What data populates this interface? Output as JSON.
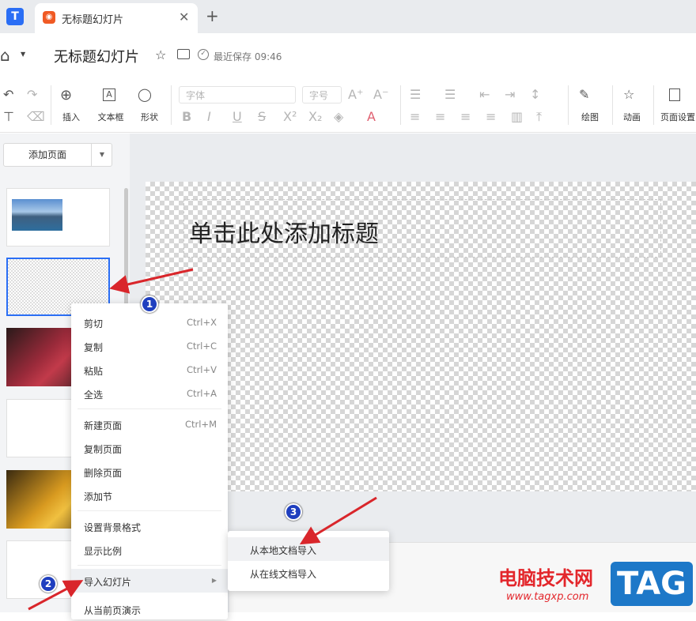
{
  "tab": {
    "title": "无标题幻灯片",
    "close": "✕",
    "new_tab": "+"
  },
  "header": {
    "doc_title": "无标题幻灯片",
    "save_status": "最近保存 09:46"
  },
  "toolbar": {
    "insert": "插入",
    "textbox": "文本框",
    "shape": "形状",
    "font_placeholder": "字体",
    "size_placeholder": "字号",
    "draw": "绘图",
    "animation": "动画",
    "page_setup": "页面设置"
  },
  "sidebar": {
    "add_page": "添加页面"
  },
  "slide": {
    "title_placeholder": "单击此处添加标题"
  },
  "context_menu": {
    "items": [
      {
        "label": "剪切",
        "shortcut": "Ctrl+X"
      },
      {
        "label": "复制",
        "shortcut": "Ctrl+C"
      },
      {
        "label": "粘贴",
        "shortcut": "Ctrl+V"
      },
      {
        "label": "全选",
        "shortcut": "Ctrl+A"
      },
      {
        "label": "新建页面",
        "shortcut": "Ctrl+M"
      },
      {
        "label": "复制页面",
        "shortcut": ""
      },
      {
        "label": "删除页面",
        "shortcut": ""
      },
      {
        "label": "添加节",
        "shortcut": ""
      },
      {
        "label": "设置背景格式",
        "shortcut": ""
      },
      {
        "label": "显示比例",
        "shortcut": ""
      },
      {
        "label": "导入幻灯片",
        "shortcut": ""
      },
      {
        "label": "从当前页演示",
        "shortcut": ""
      }
    ]
  },
  "submenu": {
    "items": [
      "从本地文档导入",
      "从在线文档导入"
    ]
  },
  "annotations": [
    "1",
    "2",
    "3"
  ],
  "watermark": {
    "text": "电脑技术网",
    "url": "www.tagxp.com",
    "tag": "TAG"
  },
  "colors": {
    "accent": "#2a6ef5",
    "arrow": "#d9262b",
    "badge": "#1f3fbf"
  }
}
